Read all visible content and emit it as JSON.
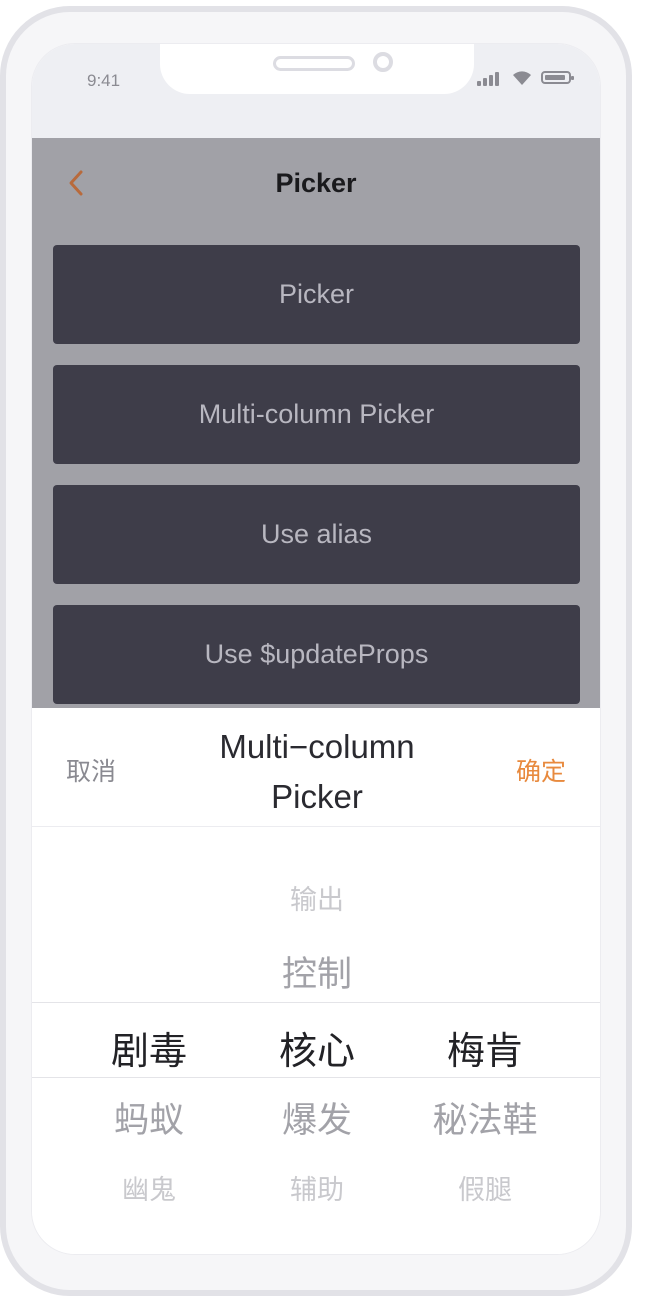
{
  "status_bar": {
    "time": "9:41"
  },
  "navbar": {
    "title": "Picker"
  },
  "buttons": [
    {
      "label": "Picker"
    },
    {
      "label": "Multi-column Picker"
    },
    {
      "label": "Use alias"
    },
    {
      "label": "Use $updateProps"
    }
  ],
  "picker": {
    "cancel_label": "取消",
    "title_line1": "Multi−column",
    "title_line2": "Picker",
    "confirm_label": "确定",
    "columns": [
      {
        "items": [
          "",
          "",
          "剧毒",
          "蚂蚁",
          "幽鬼"
        ]
      },
      {
        "items": [
          "输出",
          "控制",
          "核心",
          "爆发",
          "辅助"
        ]
      },
      {
        "items": [
          "",
          "",
          "梅肯",
          "秘法鞋",
          "假腿"
        ]
      }
    ]
  },
  "colors": {
    "accent": "#e88a3e",
    "navbar_bg": "#a1a1a7",
    "button_bg": "#3e3d49",
    "button_text": "#b8b7c0"
  }
}
